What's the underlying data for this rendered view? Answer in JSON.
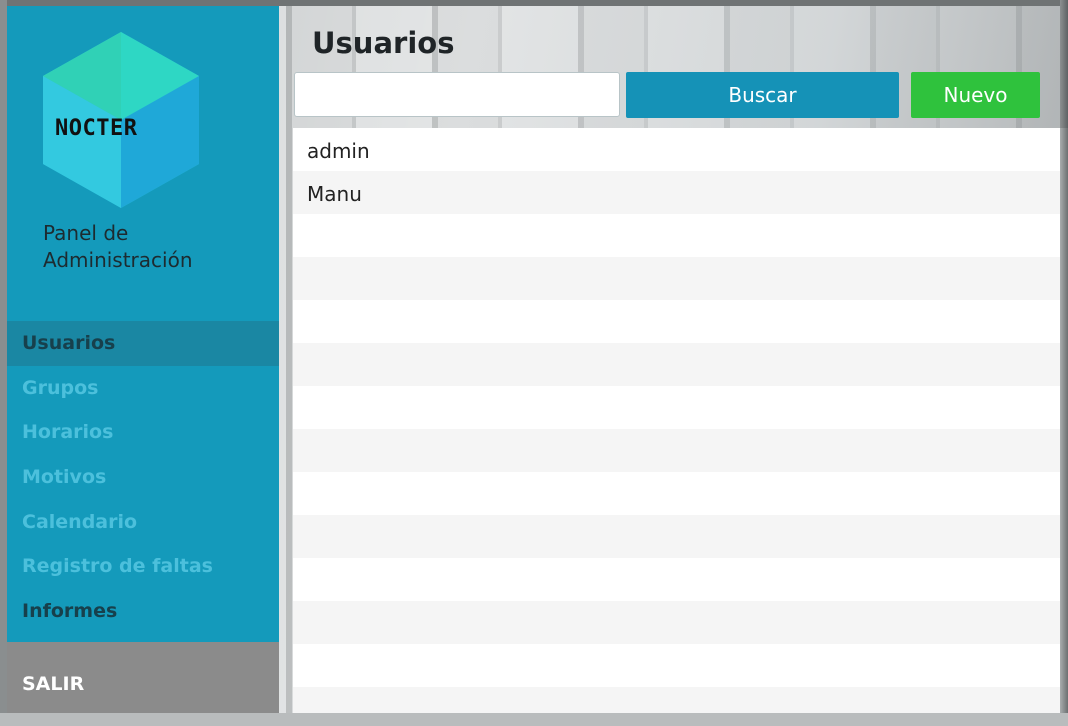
{
  "brand": {
    "logo_text": "NOCTER",
    "panel_title": "Panel de Administración"
  },
  "menu": [
    {
      "label": "Usuarios",
      "state": "active"
    },
    {
      "label": "Grupos",
      "state": "muted"
    },
    {
      "label": "Horarios",
      "state": "muted"
    },
    {
      "label": "Motivos",
      "state": "muted"
    },
    {
      "label": "Calendario",
      "state": "muted"
    },
    {
      "label": "Registro de faltas",
      "state": "muted"
    },
    {
      "label": "Informes",
      "state": "normal"
    }
  ],
  "logout_label": "SALIR",
  "main": {
    "title": "Usuarios",
    "search": {
      "value": "",
      "placeholder": ""
    },
    "search_button": "Buscar",
    "new_button": "Nuevo"
  },
  "users": [
    "admin",
    "Manu"
  ],
  "colors": {
    "sidebar": "#149abb",
    "active_item": "#1a87a3",
    "search_button": "#1592b7",
    "new_button": "#2fc23d",
    "logout_bg": "#8b8b8b"
  }
}
